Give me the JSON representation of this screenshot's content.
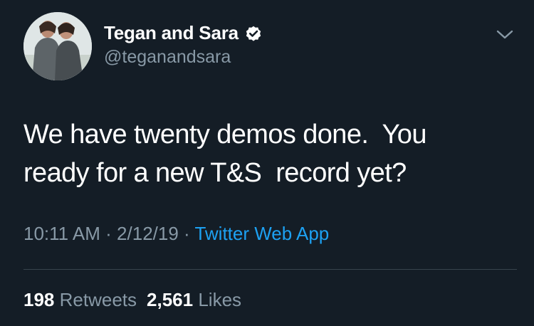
{
  "user": {
    "display_name": "Tegan and Sara",
    "handle": "@teganandsara",
    "verified": true
  },
  "tweet": {
    "text": "We have twenty demos done.  You\nready for a new T&S  record yet?",
    "time": "10:11 AM",
    "separator": " · ",
    "date": "2/12/19",
    "source": "Twitter Web App"
  },
  "stats": {
    "retweets_count": "198",
    "retweets_label": "Retweets",
    "likes_count": "2,561",
    "likes_label": "Likes"
  },
  "icons": {
    "verified": "verified-badge-icon",
    "menu": "chevron-down-icon"
  },
  "colors": {
    "background": "#141d26",
    "text": "#ffffff",
    "secondary_text": "#8899a6",
    "link": "#1da1f2",
    "divider": "#38444d"
  }
}
